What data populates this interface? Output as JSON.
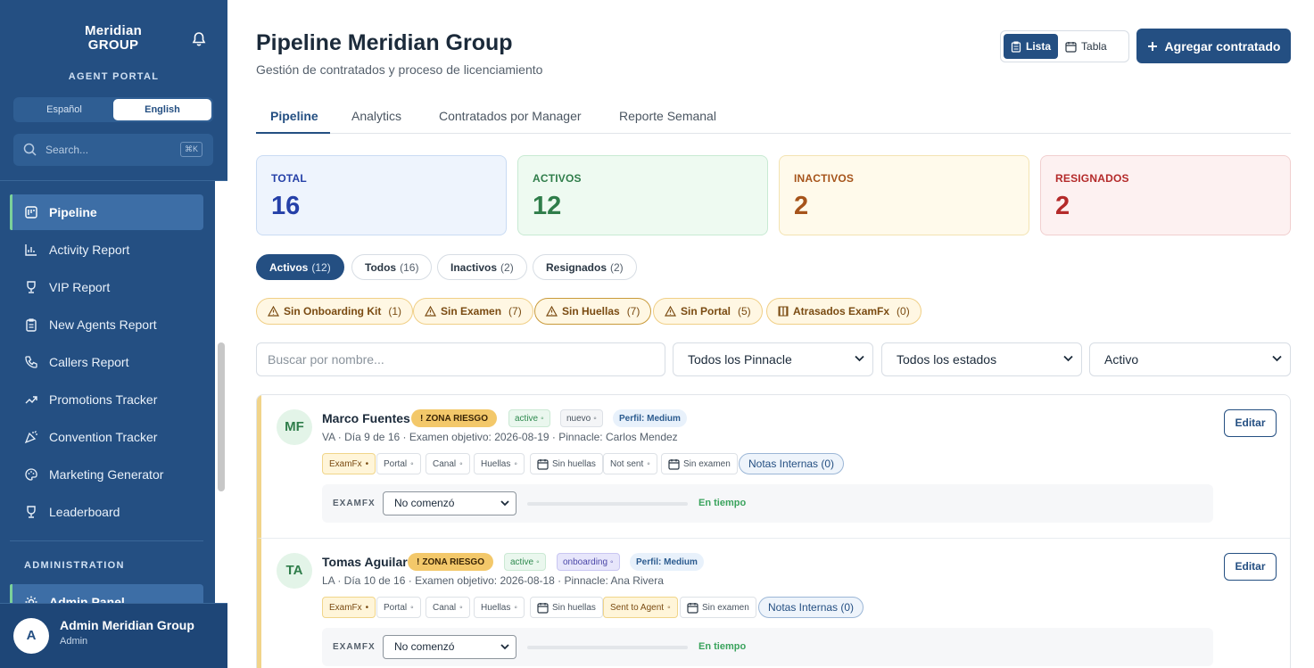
{
  "sidebar": {
    "logo_line1": "Meridian",
    "logo_line2": "GROUP",
    "portal_label": "AGENT PORTAL",
    "lang_es": "Español",
    "lang_en": "English",
    "search_placeholder": "Search...",
    "search_kbd": "⌘K",
    "items": [
      {
        "label": "Pipeline",
        "icon": "pipeline-icon"
      },
      {
        "label": "Activity Report",
        "icon": "chart-icon"
      },
      {
        "label": "VIP Report",
        "icon": "trophy-icon"
      },
      {
        "label": "New Agents Report",
        "icon": "clipboard-icon"
      },
      {
        "label": "Callers Report",
        "icon": "phone-icon"
      },
      {
        "label": "Promotions Tracker",
        "icon": "trend-icon"
      },
      {
        "label": "Convention Tracker",
        "icon": "party-icon"
      },
      {
        "label": "Marketing Generator",
        "icon": "palette-icon"
      },
      {
        "label": "Leaderboard",
        "icon": "trophy-icon"
      }
    ],
    "admin_label": "ADMINISTRATION",
    "admin_item": "Admin Panel",
    "user": {
      "initial": "A",
      "name": "Admin Meridian Group",
      "role": "Admin"
    }
  },
  "header": {
    "title": "Pipeline Meridian Group",
    "subtitle": "Gestión de contratados y proceso de licenciamiento",
    "view_list": "Lista",
    "view_table": "Tabla",
    "add_button": "Agregar contratado"
  },
  "tabs": [
    "Pipeline",
    "Analytics",
    "Contratados por Manager",
    "Reporte Semanal"
  ],
  "stats": [
    {
      "label": "TOTAL",
      "value": "16"
    },
    {
      "label": "ACTIVOS",
      "value": "12"
    },
    {
      "label": "INACTIVOS",
      "value": "2"
    },
    {
      "label": "RESIGNADOS",
      "value": "2"
    }
  ],
  "status_pills": [
    {
      "label": "Activos",
      "count": "(12)"
    },
    {
      "label": "Todos",
      "count": "(16)"
    },
    {
      "label": "Inactivos",
      "count": "(2)"
    },
    {
      "label": "Resignados",
      "count": "(2)"
    }
  ],
  "warnings": [
    {
      "label": "Sin Onboarding Kit",
      "count": "(1)"
    },
    {
      "label": "Sin Examen",
      "count": "(7)"
    },
    {
      "label": "Sin Huellas",
      "count": "(7)"
    },
    {
      "label": "Sin Portal",
      "count": "(5)"
    },
    {
      "label": "Atrasados ExamFx",
      "count": "(0)"
    }
  ],
  "filters": {
    "search_placeholder": "Buscar por nombre...",
    "pinnacle": "Todos los Pinnacle",
    "estados": "Todos los estados",
    "activo": "Activo"
  },
  "agents": [
    {
      "initials": "MF",
      "name": "Marco Fuentes",
      "risk": "ZONA RIESGO",
      "status": "active",
      "stage": "nuevo",
      "profile": "Perfil: Medium",
      "meta": "VA · Día 9 de 16 · Examen objetivo: 2026-08-19 · Pinnacle: Carlos Mendez",
      "tags": [
        "ExamFx",
        "Portal",
        "Canal",
        "Huellas",
        "Sin huellas",
        "Not sent",
        "Sin examen"
      ],
      "notes": "Notas Internas (0)",
      "exam_label": "EXAMFX",
      "exam_select": "No comenzó",
      "exam_progress": 0,
      "exam_status": "En tiempo",
      "edit": "Editar"
    },
    {
      "initials": "TA",
      "name": "Tomas Aguilar",
      "risk": "ZONA RIESGO",
      "status": "active",
      "stage": "onboarding",
      "profile": "Perfil: Medium",
      "meta": "LA · Día 10 de 16 · Examen objetivo: 2026-08-18 · Pinnacle: Ana Rivera",
      "tags": [
        "ExamFx",
        "Portal",
        "Canal",
        "Huellas",
        "Sin huellas",
        "Sent to Agent",
        "Sin examen"
      ],
      "notes": "Notas Internas (0)",
      "exam_label": "EXAMFX",
      "exam_select": "No comenzó",
      "exam_progress": 0,
      "exam_status": "En tiempo",
      "edit": "Editar"
    }
  ],
  "colors": {
    "primary": "#244f82",
    "total": "#2540a8",
    "activos": "#2f7d4a",
    "inactivos": "#a6541b",
    "resignados": "#b42a2a",
    "risk": "#f3c86a"
  }
}
